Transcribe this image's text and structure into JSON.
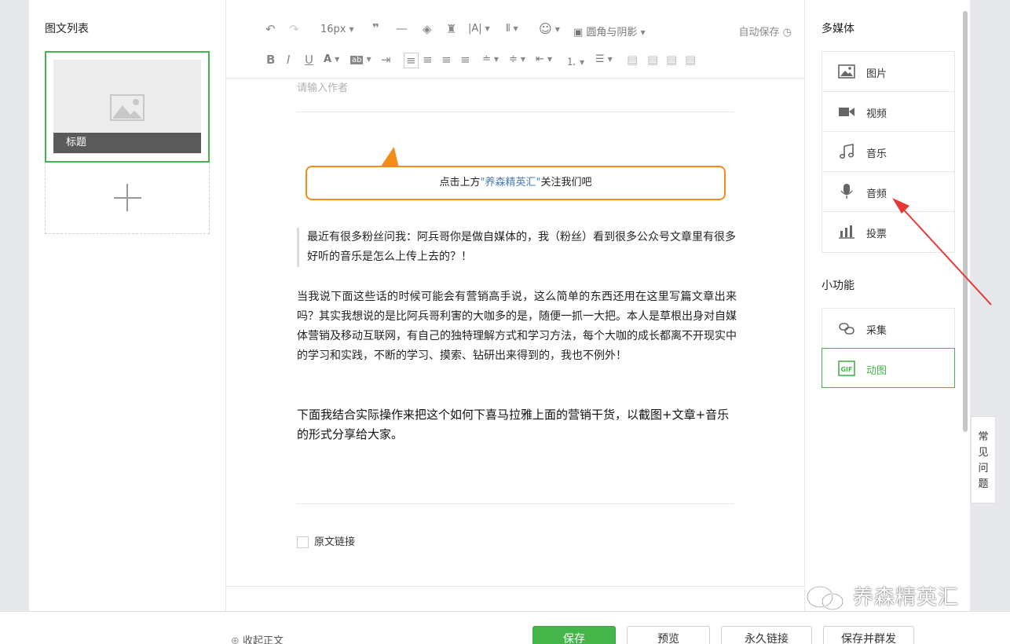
{
  "left": {
    "title": "图文列表",
    "card_title": "标题"
  },
  "toolbar": {
    "font_size": "16px",
    "radius_shadow": "圆角与阴影",
    "autosave": "自动保存"
  },
  "editor": {
    "author_placeholder": "请输入作者",
    "callout_pre": "点击上方",
    "callout_highlight": "\"养森精英汇\"",
    "callout_post": "关注我们吧",
    "quote": "最近有很多粉丝问我：阿兵哥你是做自媒体的，我（粉丝）看到很多公众号文章里有很多好听的音乐是怎么上传上去的？！",
    "para1": "当我说下面这些话的时候可能会有营销高手说，这么简单的东西还用在这里写篇文章出来吗？其实我想说的是比阿兵哥利害的大咖多的是，随便一抓一大把。本人是草根出身对自媒体营销及移动互联网，有自己的独特理解方式和学习方法，每个大咖的成长都离不开现实中的学习和实践，不断的学习、摸索、钻研出来得到的，我也不例外！",
    "para2": "下面我结合实际操作来把这个如何下喜马拉雅上面的营销干货，以截图+文章+音乐的形式分享给大家。",
    "origin_link": "原文链接"
  },
  "right": {
    "media_title": "多媒体",
    "media_items": [
      {
        "label": "图片",
        "icon": "image-icon"
      },
      {
        "label": "视频",
        "icon": "video-icon"
      },
      {
        "label": "音乐",
        "icon": "music-icon"
      },
      {
        "label": "音频",
        "icon": "microphone-icon"
      },
      {
        "label": "投票",
        "icon": "vote-icon"
      }
    ],
    "tools_title": "小功能",
    "tool_items": [
      {
        "label": "采集",
        "icon": "link-icon"
      },
      {
        "label": "动图",
        "icon": "gif-icon"
      }
    ]
  },
  "faq": [
    "常",
    "见",
    "问",
    "题"
  ],
  "bottom": {
    "collapse": "收起正文",
    "save": "保存",
    "preview": "预览",
    "permalink": "永久链接",
    "save_publish": "保存并群发"
  },
  "watermark": "养森精英汇",
  "colors": {
    "accent": "#44b549",
    "callout_border": "#f28d1a",
    "arrow": "#e53935"
  }
}
